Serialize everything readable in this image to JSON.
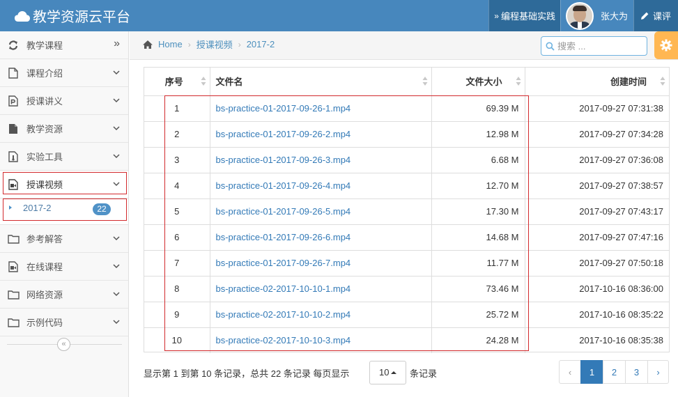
{
  "navbar": {
    "brand": "教学资源云平台",
    "practice_label": "编程基础实践",
    "user_name": "张大为",
    "review_label": "课评"
  },
  "sidebar": {
    "items": [
      {
        "label": "教学课程",
        "icon": "refresh-icon",
        "indicator": "»"
      },
      {
        "label": "课程介绍",
        "icon": "file-icon"
      },
      {
        "label": "授课讲义",
        "icon": "file-powerpoint-icon"
      },
      {
        "label": "教学资源",
        "icon": "file-solid-icon"
      },
      {
        "label": "实验工具",
        "icon": "file-tool-icon"
      },
      {
        "label": "授课视频",
        "icon": "video-file-icon",
        "active": true
      },
      {
        "label": "参考解答",
        "icon": "folder-icon"
      },
      {
        "label": "在线课程",
        "icon": "video-file-icon"
      },
      {
        "label": "网络资源",
        "icon": "folder-icon"
      },
      {
        "label": "示例代码",
        "icon": "folder-icon"
      }
    ],
    "sub_item": {
      "label": "2017-2",
      "badge": "22"
    },
    "collapse_glyph": "«"
  },
  "breadcrumb": {
    "home": "Home",
    "section": "授课视频",
    "current": "2017-2"
  },
  "search": {
    "placeholder": "搜索 ..."
  },
  "table": {
    "headers": {
      "no": "序号",
      "name": "文件名",
      "size": "文件大小",
      "time": "创建时间"
    },
    "rows": [
      {
        "no": "1",
        "name": "bs-practice-01-2017-09-26-1.mp4",
        "size": "69.39 M",
        "time": "2017-09-27 07:31:38"
      },
      {
        "no": "2",
        "name": "bs-practice-01-2017-09-26-2.mp4",
        "size": "12.98 M",
        "time": "2017-09-27 07:34:28"
      },
      {
        "no": "3",
        "name": "bs-practice-01-2017-09-26-3.mp4",
        "size": "6.68 M",
        "time": "2017-09-27 07:36:08"
      },
      {
        "no": "4",
        "name": "bs-practice-01-2017-09-26-4.mp4",
        "size": "12.70 M",
        "time": "2017-09-27 07:38:57"
      },
      {
        "no": "5",
        "name": "bs-practice-01-2017-09-26-5.mp4",
        "size": "17.30 M",
        "time": "2017-09-27 07:43:17"
      },
      {
        "no": "6",
        "name": "bs-practice-01-2017-09-26-6.mp4",
        "size": "14.68 M",
        "time": "2017-09-27 07:47:16"
      },
      {
        "no": "7",
        "name": "bs-practice-01-2017-09-26-7.mp4",
        "size": "11.77 M",
        "time": "2017-09-27 07:50:18"
      },
      {
        "no": "8",
        "name": "bs-practice-02-2017-10-10-1.mp4",
        "size": "73.46 M",
        "time": "2017-10-16 08:36:00"
      },
      {
        "no": "9",
        "name": "bs-practice-02-2017-10-10-2.mp4",
        "size": "25.72 M",
        "time": "2017-10-16 08:35:22"
      },
      {
        "no": "10",
        "name": "bs-practice-02-2017-10-10-3.mp4",
        "size": "24.28 M",
        "time": "2017-10-16 08:35:38"
      }
    ]
  },
  "footer": {
    "info": "显示第 1 到第 10 条记录，总共 22 条记录 每页显示",
    "per_page": "10",
    "info_suffix": "条记录",
    "pages": [
      "‹",
      "1",
      "2",
      "3",
      "›"
    ],
    "active_page": "1"
  },
  "colors": {
    "navbar": "#4787bd",
    "navbar_dark": "#2e6a99",
    "highlight_border": "#d2292c",
    "link": "#337ab7",
    "settings_button": "#ffb752",
    "badge": "#5092c7"
  }
}
